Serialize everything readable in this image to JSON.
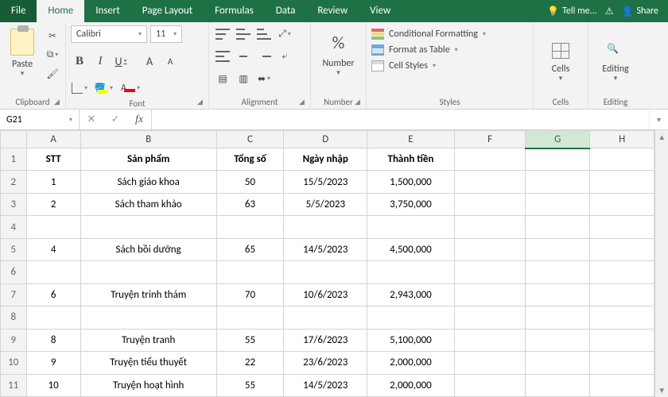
{
  "tabs": {
    "file": "File",
    "items": [
      "Home",
      "Insert",
      "Page Layout",
      "Formulas",
      "Data",
      "Review",
      "View"
    ],
    "tell_me": "Tell me...",
    "share": "Share"
  },
  "ribbon": {
    "clipboard": {
      "paste": "Paste",
      "label": "Clipboard"
    },
    "font": {
      "name": "Calibri",
      "size": "11",
      "bold": "B",
      "italic": "I",
      "underline": "U",
      "grow": "A",
      "shrink": "A",
      "fill_letter": "A",
      "font_letter": "A",
      "label": "Font"
    },
    "alignment": {
      "label": "Alignment"
    },
    "number": {
      "pct": "%",
      "title": "Number",
      "label": "Number"
    },
    "styles": {
      "cond_fmt": "Conditional Formatting",
      "fmt_table": "Format as Table",
      "cell_styles": "Cell Styles",
      "label": "Styles"
    },
    "cells": {
      "title": "Cells",
      "label": "Cells"
    },
    "editing": {
      "title": "Editing",
      "label": "Editing"
    }
  },
  "formula_bar": {
    "name_box": "G21",
    "cancel": "✕",
    "enter": "✓",
    "fx": "fx",
    "formula": ""
  },
  "sheet": {
    "columns": [
      "A",
      "B",
      "C",
      "D",
      "E",
      "F",
      "G",
      "H"
    ],
    "selected_col": "G",
    "row_numbers": [
      "1",
      "2",
      "3",
      "4",
      "5",
      "6",
      "7",
      "8",
      "9",
      "10",
      "11"
    ],
    "header_row": {
      "A": "STT",
      "B": "Sản phẩm",
      "C": "Tổng số",
      "D": "Ngày nhập",
      "E": "Thành tiền"
    },
    "rows": [
      {
        "A": "1",
        "B": "Sách giáo khoa",
        "C": "50",
        "D": "15/5/2023",
        "E": "1,500,000"
      },
      {
        "A": "2",
        "B": "Sách tham khảo",
        "C": "63",
        "D": "5/5/2023",
        "E": "3,750,000"
      },
      {
        "A": "",
        "B": "",
        "C": "",
        "D": "",
        "E": ""
      },
      {
        "A": "4",
        "B": "Sách bồi dưỡng",
        "C": "65",
        "D": "14/5/2023",
        "E": "4,500,000"
      },
      {
        "A": "",
        "B": "",
        "C": "",
        "D": "",
        "E": ""
      },
      {
        "A": "6",
        "B": "Truyện trinh thám",
        "C": "70",
        "D": "10/6/2023",
        "E": "2,943,000"
      },
      {
        "A": "",
        "B": "",
        "C": "",
        "D": "",
        "E": ""
      },
      {
        "A": "8",
        "B": "Truyện tranh",
        "C": "55",
        "D": "17/6/2023",
        "E": "5,100,000"
      },
      {
        "A": "9",
        "B": "Truyện tiểu thuyết",
        "C": "22",
        "D": "23/6/2023",
        "E": "2,000,000"
      },
      {
        "A": "10",
        "B": "Truyện hoạt hình",
        "C": "55",
        "D": "14/5/2023",
        "E": "2,000,000"
      }
    ]
  }
}
